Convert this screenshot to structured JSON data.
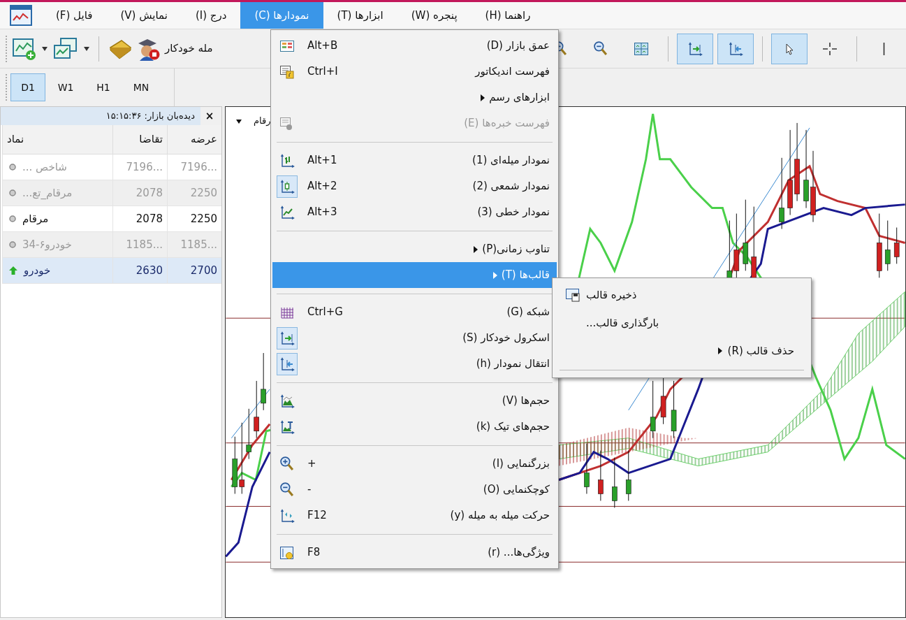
{
  "menubar": [
    {
      "label": "راهنما (H)",
      "selected": false
    },
    {
      "label": "پنجره (W)",
      "selected": false
    },
    {
      "label": "ابزارها (T)",
      "selected": false
    },
    {
      "label": "نمودارها (C)",
      "selected": true
    },
    {
      "label": "درج (I)",
      "selected": false
    },
    {
      "label": "نمایش (V)",
      "selected": false
    },
    {
      "label": "فایل (F)",
      "selected": false
    }
  ],
  "toolbar_left": {
    "cut_label": "مله خودکار"
  },
  "toolbar_right": [
    {
      "kind": "button",
      "pressed": false
    },
    {
      "kind": "button",
      "pressed": false
    },
    {
      "kind": "button",
      "pressed": false
    },
    {
      "kind": "separator"
    },
    {
      "kind": "button",
      "pressed": true
    },
    {
      "kind": "button",
      "pressed": true
    },
    {
      "kind": "separator"
    },
    {
      "kind": "button",
      "pressed": true
    },
    {
      "kind": "button",
      "pressed": false
    },
    {
      "kind": "separator"
    },
    {
      "kind": "button",
      "pressed": false
    }
  ],
  "timeframes": [
    {
      "label": "MN",
      "selected": false
    },
    {
      "label": "H1",
      "selected": false
    },
    {
      "label": "W1",
      "selected": false
    },
    {
      "label": "D1",
      "selected": true
    }
  ],
  "market_watch": {
    "title": "دیده‌بان بازار: ۱۵:۱۵:۳۶",
    "close": "×",
    "columns": [
      "عرضه",
      "تقاضا",
      "نماد"
    ],
    "rows": [
      {
        "symbol": "شاخص ...",
        "bid": "7196...",
        "ask": "7196...",
        "kind": "dot",
        "dimmed": true,
        "selected": false
      },
      {
        "symbol": "مرقام_تع...",
        "bid": "2078",
        "ask": "2250",
        "kind": "dot",
        "dimmed": true,
        "selected": false
      },
      {
        "symbol": "مرقام",
        "bid": "2078",
        "ask": "2250",
        "kind": "dot",
        "dimmed": false,
        "selected": false
      },
      {
        "symbol": "خودرو۶-34",
        "bid": "1185...",
        "ask": "1185...",
        "kind": "dot",
        "dimmed": true,
        "selected": false
      },
      {
        "symbol": "خودرو",
        "bid": "2630",
        "ask": "2700",
        "kind": "up",
        "dimmed": false,
        "selected": true
      }
    ]
  },
  "chart": {
    "symbol_label": "رقام"
  },
  "menu": {
    "items": [
      {
        "kind": "item",
        "label": "عمق بازار (D)",
        "shortcut": "Alt+B",
        "submenu": false,
        "disabled": false,
        "checked": false,
        "selected": false
      },
      {
        "kind": "item",
        "label": "فهرست اندیکاتور",
        "shortcut": "Ctrl+I",
        "submenu": false,
        "disabled": false,
        "checked": false,
        "selected": false
      },
      {
        "kind": "item",
        "label": "ابزارهای رسم",
        "submenu": true,
        "disabled": false,
        "checked": false,
        "selected": false
      },
      {
        "kind": "item",
        "label": "فهرست خبره‌ها (E)",
        "submenu": false,
        "disabled": true,
        "checked": false,
        "selected": false
      },
      {
        "kind": "separator"
      },
      {
        "kind": "item",
        "label": "نمودار میله‌ای (1)",
        "shortcut": "Alt+1",
        "submenu": false,
        "disabled": false,
        "checked": false,
        "selected": false
      },
      {
        "kind": "item",
        "label": "نمودار شمعی (2)",
        "shortcut": "Alt+2",
        "submenu": false,
        "disabled": false,
        "checked": true,
        "selected": false
      },
      {
        "kind": "item",
        "label": "نمودار خطی (3)",
        "shortcut": "Alt+3",
        "submenu": false,
        "disabled": false,
        "checked": false,
        "selected": false
      },
      {
        "kind": "separator"
      },
      {
        "kind": "item",
        "label": "تناوب زمانی(P)",
        "submenu": true,
        "disabled": false,
        "checked": false,
        "selected": false
      },
      {
        "kind": "item",
        "label": "قالب‌ها (T)",
        "submenu": true,
        "disabled": false,
        "checked": false,
        "selected": true
      },
      {
        "kind": "separator"
      },
      {
        "kind": "item",
        "label": "شبکه (G)",
        "shortcut": "Ctrl+G",
        "submenu": false,
        "disabled": false,
        "checked": false,
        "selected": false
      },
      {
        "kind": "item",
        "label": "اسکرول خودکار (S)",
        "submenu": false,
        "disabled": false,
        "checked": true,
        "selected": false
      },
      {
        "kind": "item",
        "label": "انتقال نمودار (h)",
        "submenu": false,
        "disabled": false,
        "checked": true,
        "selected": false
      },
      {
        "kind": "separator"
      },
      {
        "kind": "item",
        "label": "حجم‌ها (V)",
        "submenu": false,
        "disabled": false,
        "checked": false,
        "selected": false
      },
      {
        "kind": "item",
        "label": "حجم‌های تیک (k)",
        "submenu": false,
        "disabled": false,
        "checked": false,
        "selected": false
      },
      {
        "kind": "separator"
      },
      {
        "kind": "item",
        "label": "بزرگنمایی (I)",
        "shortcut": "+",
        "submenu": false,
        "disabled": false,
        "checked": false,
        "selected": false
      },
      {
        "kind": "item",
        "label": "کوچکنمایی (O)",
        "shortcut": "-",
        "submenu": false,
        "disabled": false,
        "checked": false,
        "selected": false
      },
      {
        "kind": "item",
        "label": "حرکت میله به میله (y)",
        "shortcut": "F12",
        "submenu": false,
        "disabled": false,
        "checked": false,
        "selected": false
      },
      {
        "kind": "separator"
      },
      {
        "kind": "item",
        "label": "ویژگی‌ها... (r)",
        "shortcut": "F8",
        "submenu": false,
        "disabled": false,
        "checked": false,
        "selected": false
      }
    ]
  },
  "submenu": {
    "items": [
      {
        "kind": "item",
        "label": "ذخیره قالب",
        "submenu": false
      },
      {
        "kind": "item",
        "label": "بارگذاری قالب...",
        "submenu": false
      },
      {
        "kind": "item",
        "label": "حذف قالب (R)",
        "submenu": true
      },
      {
        "kind": "separator"
      }
    ]
  }
}
